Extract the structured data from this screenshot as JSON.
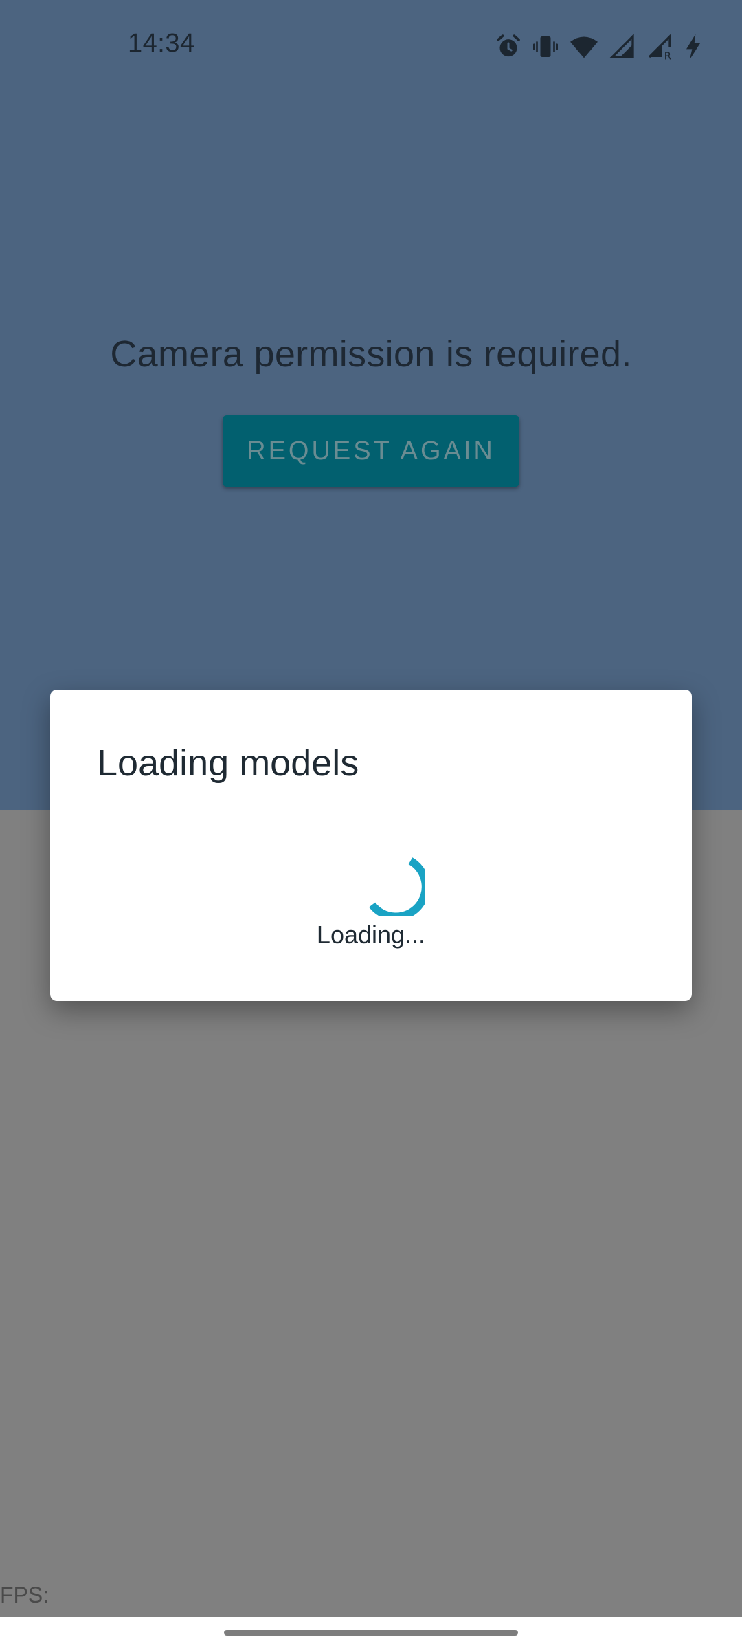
{
  "status_bar": {
    "time": "14:34",
    "icons": [
      "alarm-icon",
      "vibrate-icon",
      "wifi-icon",
      "signal-icon",
      "signal-roaming-icon",
      "charging-icon"
    ]
  },
  "permission": {
    "message": "Camera permission is required.",
    "request_label": "REQUEST AGAIN"
  },
  "dialog": {
    "title": "Loading models",
    "loading_text": "Loading..."
  },
  "preview": {
    "fps_label": "FPS:"
  },
  "colors": {
    "accent": "#02606f",
    "spinner": "#1aa3c4",
    "scrim_top": "#4c6480",
    "scrim_bottom": "#808080"
  }
}
